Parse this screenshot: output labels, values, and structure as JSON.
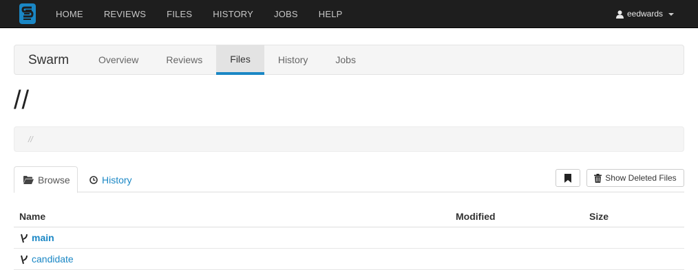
{
  "topnav": {
    "items": [
      "HOME",
      "REVIEWS",
      "FILES",
      "HISTORY",
      "JOBS",
      "HELP"
    ],
    "user": "eedwards"
  },
  "project": {
    "name": "Swarm",
    "tabs": [
      "Overview",
      "Reviews",
      "Files",
      "History",
      "Jobs"
    ],
    "active_tab": "Files"
  },
  "page": {
    "title": "//",
    "breadcrumb": "//"
  },
  "file_tabs": {
    "browse": "Browse",
    "history": "History",
    "show_deleted": "Show Deleted Files"
  },
  "table": {
    "headers": {
      "name": "Name",
      "modified": "Modified",
      "size": "Size"
    },
    "rows": [
      {
        "name": "main",
        "modified": "",
        "size": "",
        "bold": true
      },
      {
        "name": "candidate",
        "modified": "",
        "size": "",
        "bold": false
      }
    ]
  },
  "colors": {
    "accent": "#1a87c5",
    "navbar": "#1e1e1e"
  }
}
